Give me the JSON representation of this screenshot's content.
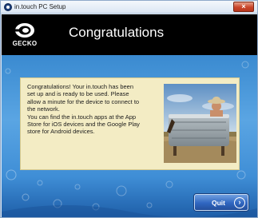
{
  "window": {
    "title": "in.touch PC Setup",
    "close_icon": "×"
  },
  "header": {
    "logo_text": "GECKO",
    "heading": "Congratulations"
  },
  "message": {
    "lines": [
      "Congratulations! Your in.touch has been",
      "set up and is ready to be used. Please",
      "allow a minute for the device to connect to",
      "the network.",
      "You can find the in.touch apps at the App",
      "Store for iOS devices and the Google Play",
      "store for Android devices."
    ]
  },
  "quit_button": {
    "label": "Quit",
    "icon": "›"
  },
  "colors": {
    "header_bg": "#000000",
    "content_blue": "#3a8ad0",
    "panel_bg": "#f3ecc4",
    "close_red": "#c9452a",
    "button_blue": "#2f66c0"
  },
  "icons": [
    "app-icon",
    "close-icon",
    "gecko-logo-icon",
    "arrow-right-circle-icon"
  ]
}
